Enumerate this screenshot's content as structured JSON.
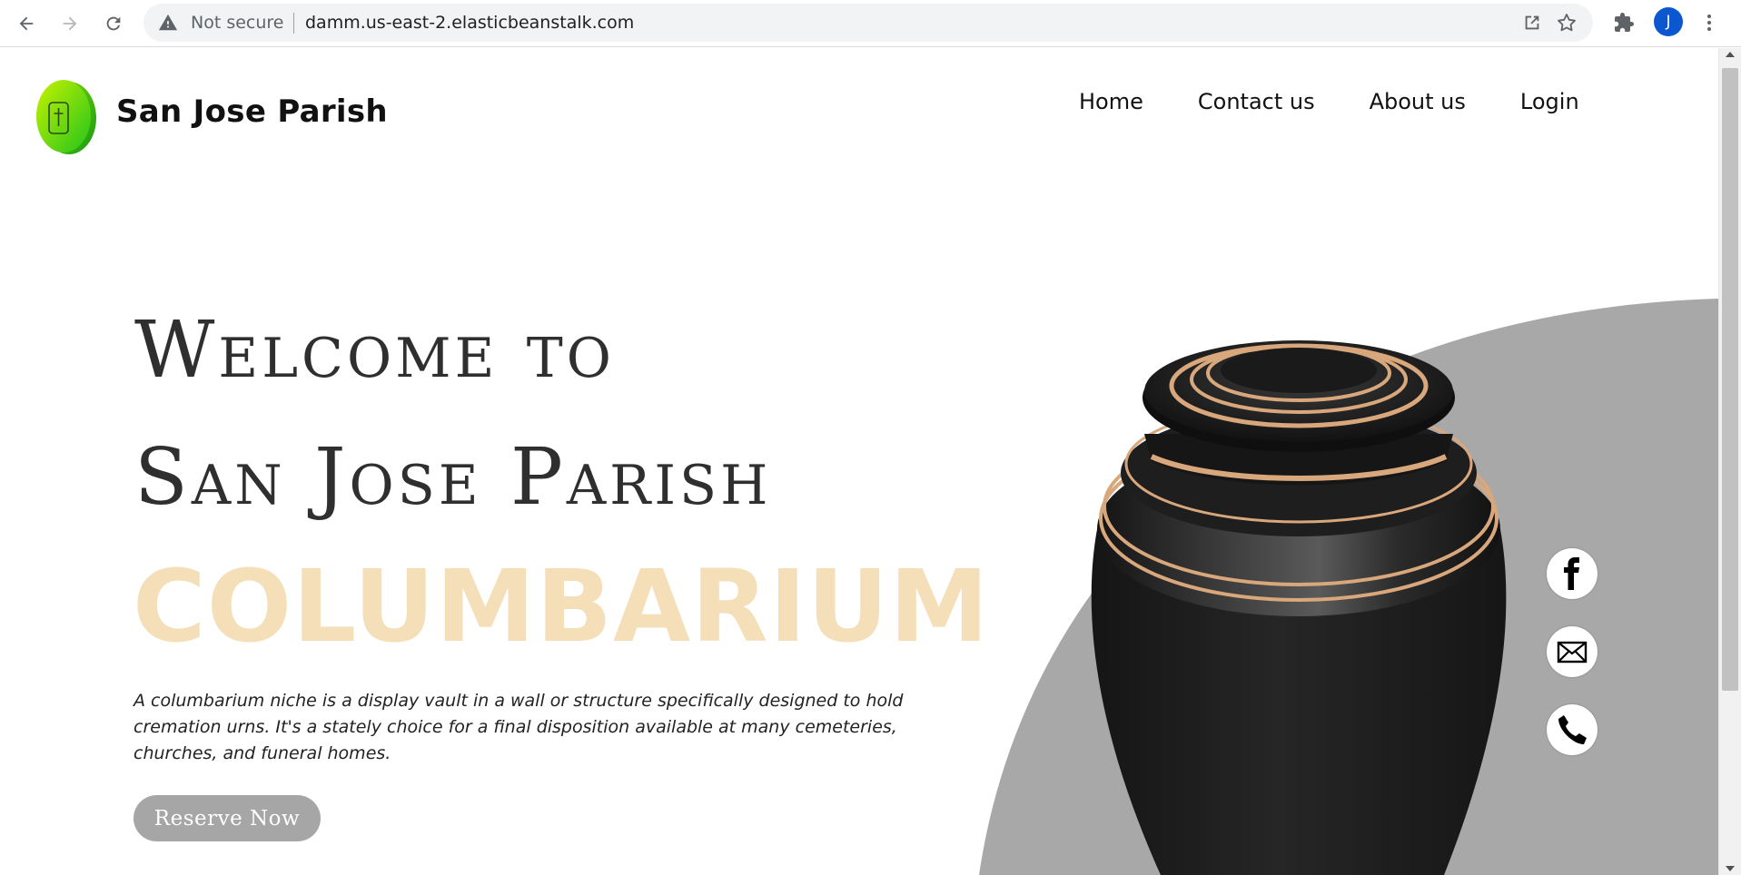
{
  "browser": {
    "security_status": "Not secure",
    "url": "damm.us-east-2.elasticbeanstalk.com",
    "profile_initial": "J",
    "icons": [
      "back-icon",
      "forward-icon",
      "reload-icon",
      "warning-icon",
      "share-icon",
      "star-icon",
      "puzzle-icon",
      "kebab-menu-icon"
    ]
  },
  "header": {
    "site_title": "San Jose Parish",
    "logo_icon": "urn-cross-icon",
    "nav": [
      {
        "label": "Home"
      },
      {
        "label": "Contact us"
      },
      {
        "label": "About us"
      },
      {
        "label": "Login"
      }
    ]
  },
  "hero": {
    "line1": "Welcome to",
    "line2": "San Jose Parish",
    "highlight": "COLUMBARIUM",
    "description": "A columbarium niche is a display vault in a wall or structure specifically designed to hold cremation urns. It's a stately choice for a final disposition available at many cemeteries, churches, and funeral homes.",
    "cta_label": "Reserve Now"
  },
  "socials": [
    {
      "name": "facebook-icon"
    },
    {
      "name": "email-icon"
    },
    {
      "name": "phone-icon"
    }
  ],
  "colors": {
    "highlight": "#f4dfb8",
    "button": "#a6a6a6",
    "backdrop": "#a8a8a8",
    "urn_body": "#1f1f1f",
    "urn_trim": "#d9a77c"
  }
}
